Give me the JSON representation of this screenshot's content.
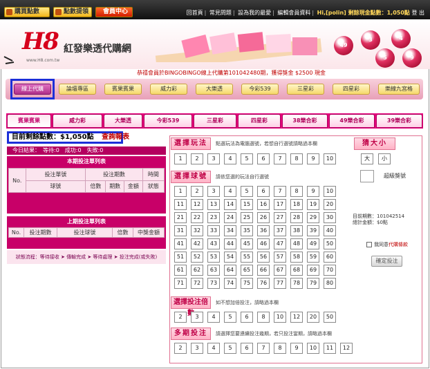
{
  "topbar": {
    "buy_points": "購買點數",
    "points_transfer": "點數提領",
    "member_center": "會員中心",
    "links": [
      "回首頁",
      "常見問題",
      "設為我的最愛",
      "編輯會員資料"
    ],
    "user_greeting": "Hi,[polin] 剩餘現金點數：1,050點",
    "logout": "登 出"
  },
  "header": {
    "logo_mark": "H8",
    "logo_name": "紅發樂透代購網",
    "logo_url": "www.H8.com.tw",
    "balls": [
      "49",
      "3",
      "4",
      "5",
      "9"
    ],
    "marquee": "恭禧會員於BINGOBINGO線上代購第101042480期，獲得獎金 $2500 現金"
  },
  "nav": {
    "items": [
      "線上代購",
      "論壇專區",
      "賓果賓果",
      "威力彩",
      "大樂透",
      "今彩539",
      "三星彩",
      "四星彩",
      "樂線九宮格"
    ]
  },
  "game_tabs": [
    "賓果賓果",
    "威力彩",
    "大樂透",
    "今彩539",
    "三星彩",
    "四星彩",
    "38樂合彩",
    "49樂合彩",
    "39樂合彩"
  ],
  "points": {
    "label": "目前剩餘點數：$1,050點",
    "link": "查詢報表"
  },
  "left": {
    "today_results": "今日結果：　等待:0　成功:0　失敗:0",
    "current_title": "本期投注單列表",
    "current_headers": {
      "no": "No.",
      "bet_type": "投注單號",
      "bet_period": "投注期數",
      "time": "時間",
      "ball": "球號",
      "multiple": "倍數",
      "periods": "期數",
      "amount": "金額",
      "status": "狀態"
    },
    "previous_title": "上期投注單列表",
    "previous_headers": {
      "no": "No.",
      "period": "投注期數",
      "balls": "投注球號",
      "multiple": "倍數",
      "prize": "中獎金額"
    },
    "status_flow": "狀態流程：等待接收 ➤ 傳輸完成 ➤ 等待處理 ➤ 投注完成(或失敗)"
  },
  "right": {
    "play_title": "選擇玩法",
    "play_note": "點選玩法為電腦選號，若想自行選號請略過本欄",
    "play_numbers": [
      "1",
      "2",
      "3",
      "4",
      "5",
      "6",
      "7",
      "8",
      "9",
      "10"
    ],
    "size_title": "猜大小",
    "size_big": "大",
    "size_small": "小",
    "ball_title": "選擇球號",
    "ball_note": "請依您選的玩法自行選號",
    "super_label": "超級獎號",
    "balls": [
      "1",
      "2",
      "3",
      "4",
      "5",
      "6",
      "7",
      "8",
      "9",
      "10",
      "11",
      "12",
      "13",
      "14",
      "15",
      "16",
      "17",
      "18",
      "19",
      "20",
      "21",
      "22",
      "23",
      "24",
      "25",
      "26",
      "27",
      "28",
      "29",
      "30",
      "31",
      "32",
      "33",
      "34",
      "35",
      "36",
      "37",
      "38",
      "39",
      "40",
      "41",
      "42",
      "43",
      "44",
      "45",
      "46",
      "47",
      "48",
      "49",
      "50",
      "51",
      "52",
      "53",
      "54",
      "55",
      "56",
      "57",
      "58",
      "59",
      "60",
      "61",
      "62",
      "63",
      "64",
      "65",
      "66",
      "67",
      "68",
      "69",
      "70",
      "71",
      "72",
      "73",
      "74",
      "75",
      "76",
      "77",
      "78",
      "79",
      "80"
    ],
    "current_period": "目前期數：101042514",
    "total_amount": "總計金額：$0點",
    "agree": "我同意",
    "agree_link": "代購條款",
    "confirm": "確定投注",
    "multi_title": "選擇投注倍數",
    "multi_note": "如不想加倍投注，請略過本欄",
    "multi_values": [
      "2",
      "3",
      "4",
      "5",
      "6",
      "8",
      "10",
      "12",
      "20",
      "50"
    ],
    "periods_title": "多期投注",
    "periods_note": "請選擇您要連續投注幾期，若只投注當期，請略過本欄",
    "periods_values": [
      "2",
      "3",
      "4",
      "5",
      "6",
      "7",
      "8",
      "9",
      "10",
      "11",
      "12"
    ]
  },
  "colors": {
    "brand": "#e4007a",
    "header_red": "#d6001c",
    "highlight_blue": "#1c2fd8"
  }
}
